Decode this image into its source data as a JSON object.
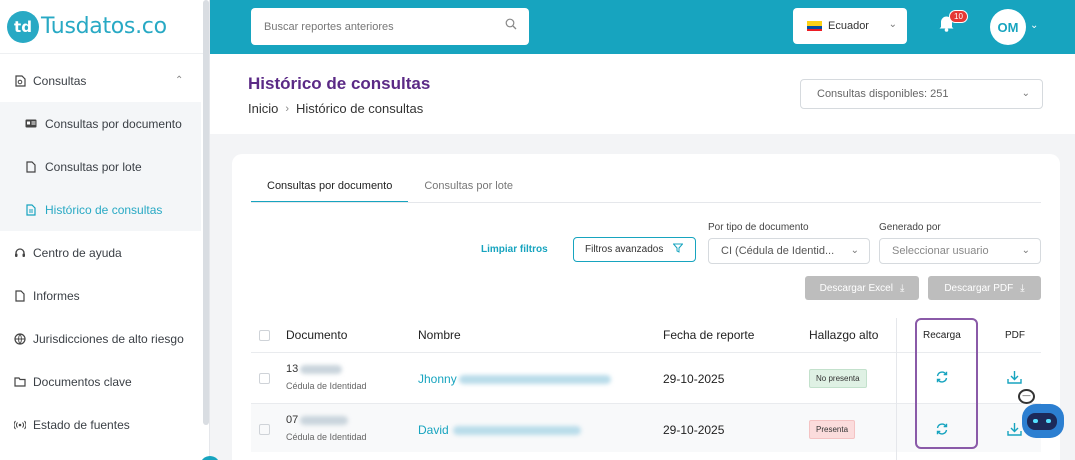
{
  "brand": {
    "logo_mark": "td",
    "name": "Tusdatos.co",
    "accent": "#17a4bf",
    "title_color": "#5b2a86"
  },
  "sidebar": {
    "items": [
      {
        "label": "Consultas",
        "icon": "document-search-icon"
      },
      {
        "label": "Centro de ayuda",
        "icon": "headset-icon"
      },
      {
        "label": "Informes",
        "icon": "file-icon"
      },
      {
        "label": "Jurisdicciones de alto riesgo",
        "icon": "globe-icon"
      },
      {
        "label": "Documentos clave",
        "icon": "folder-icon"
      },
      {
        "label": "Estado de fuentes",
        "icon": "signal-icon"
      }
    ],
    "sub_items": [
      {
        "label": "Consultas por documento",
        "icon": "id-card-icon"
      },
      {
        "label": "Consultas por lote",
        "icon": "file-icon"
      },
      {
        "label": "Histórico de consultas",
        "icon": "file-list-icon"
      }
    ]
  },
  "header": {
    "search_placeholder": "Buscar reportes anteriores",
    "country": "Ecuador",
    "notifications": "10",
    "avatar": "OM"
  },
  "page": {
    "title": "Histórico de consultas",
    "breadcrumb_home": "Inicio",
    "breadcrumb_current": "Histórico de consultas",
    "available": "Consultas disponibles: 251"
  },
  "tabs": [
    "Consultas por documento",
    "Consultas por lote"
  ],
  "filters": {
    "clear": "Limpiar filtros",
    "advanced": "Filtros avanzados",
    "doc_type_label": "Por tipo de documento",
    "doc_type_value": "CI (Cédula de Identid...",
    "generated_label": "Generado por",
    "generated_placeholder": "Seleccionar usuario",
    "excel": "Descargar Excel",
    "pdf": "Descargar PDF"
  },
  "table": {
    "headers": [
      "Documento",
      "Nombre",
      "Fecha de reporte",
      "Hallazgo alto",
      "Recarga",
      "PDF"
    ],
    "rows": [
      {
        "doc": "13",
        "doc_type": "Cédula de Identidad",
        "name": "Jhonny",
        "date": "29-10-2025",
        "status": "No presenta"
      },
      {
        "doc": "07",
        "doc_type": "Cédula de Identidad",
        "name": "David",
        "date": "29-10-2025",
        "status": "Presenta"
      }
    ]
  }
}
